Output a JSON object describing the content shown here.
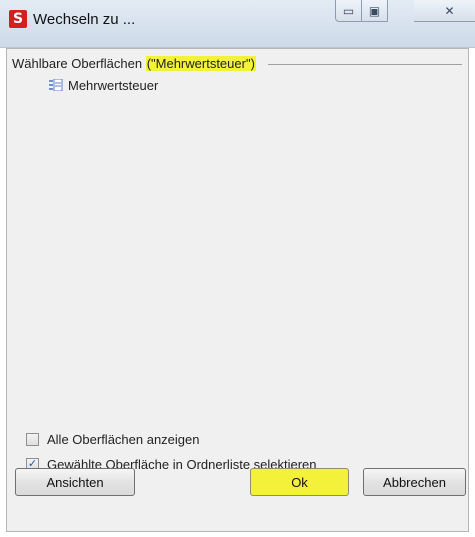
{
  "window": {
    "title": "Wechseln zu ...",
    "app_icon_letter": "S",
    "controls": {
      "minimize": "▭",
      "maximize": "▣",
      "close": "✕"
    }
  },
  "group": {
    "label": "Wählbare Oberflächen",
    "filter": "(\"Mehrwertsteuer\")"
  },
  "tree": {
    "items": [
      {
        "label": "Mehrwertsteuer",
        "icon": "form-icon"
      }
    ]
  },
  "options": {
    "show_all": {
      "label": "Alle Oberflächen anzeigen",
      "checked": false
    },
    "select_in_folder": {
      "label": "Gewählte Oberfläche in Ordnerliste selektieren",
      "checked": true,
      "check_glyph": "✓"
    }
  },
  "buttons": {
    "views": "Ansichten",
    "ok": "Ok",
    "cancel": "Abbrechen"
  },
  "colors": {
    "highlight": "#f4f13b",
    "app_icon": "#d41f1f"
  }
}
